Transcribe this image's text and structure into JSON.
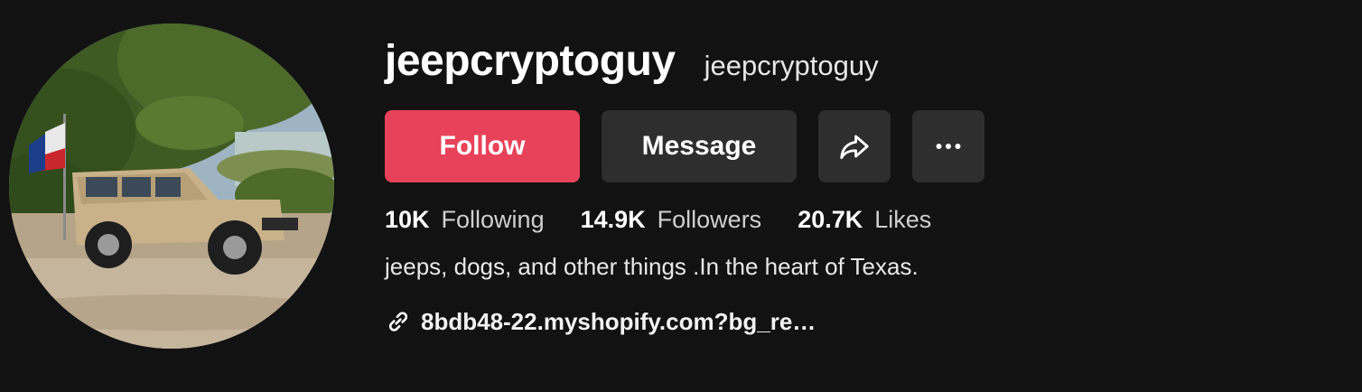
{
  "profile": {
    "username": "jeepcryptoguy",
    "nickname": "jeepcryptoguy",
    "avatar_icon": "jeep-photo-avatar"
  },
  "actions": {
    "follow_label": "Follow",
    "message_label": "Message",
    "share_icon": "share-icon",
    "more_icon": "more-icon"
  },
  "stats": [
    {
      "count": "10K",
      "label": "Following"
    },
    {
      "count": "14.9K",
      "label": "Followers"
    },
    {
      "count": "20.7K",
      "label": "Likes"
    }
  ],
  "bio": "jeeps, dogs, and other things .In the heart of Texas.",
  "link": {
    "icon": "link-icon",
    "text": "8bdb48-22.myshopify.com?bg_re…"
  },
  "colors": {
    "background": "#121212",
    "follow_button": "#e8425a",
    "secondary_button": "#2e2e2e"
  }
}
